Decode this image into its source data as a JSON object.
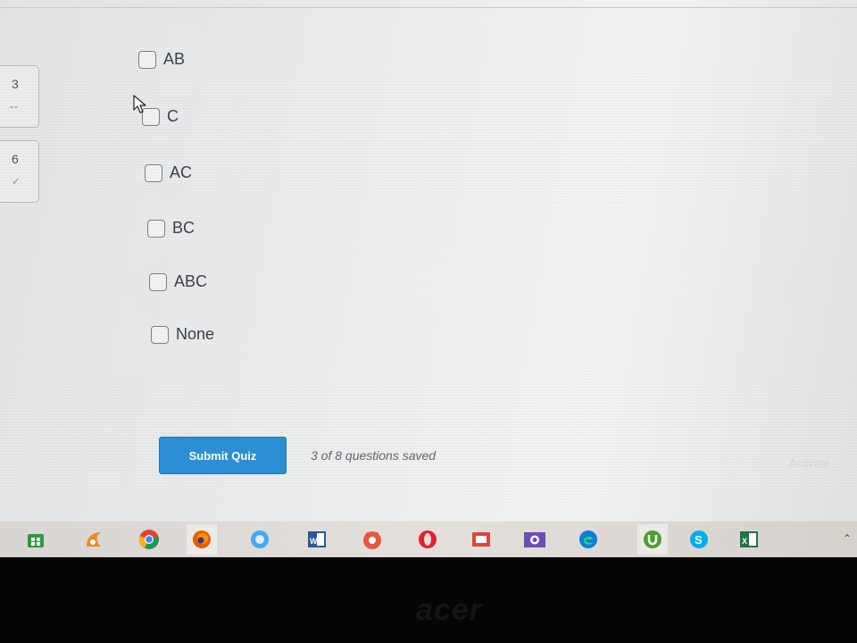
{
  "question_nav": [
    {
      "number": "3",
      "status": "--"
    },
    {
      "number": "6",
      "status": "✓"
    }
  ],
  "answer_options": [
    {
      "label": "AB",
      "checked": false
    },
    {
      "label": "C",
      "checked": false
    },
    {
      "label": "AC",
      "checked": false
    },
    {
      "label": "BC",
      "checked": false
    },
    {
      "label": "ABC",
      "checked": false
    },
    {
      "label": "None",
      "checked": false
    }
  ],
  "footer": {
    "submit_label": "Submit Quiz",
    "saved_status": "3 of 8 questions saved"
  },
  "watermark": "Activate",
  "taskbar": {
    "icons": [
      "store-icon",
      "uc-browser-icon",
      "chrome-icon",
      "firefox-icon",
      "browser-icon",
      "word-icon",
      "media-icon",
      "opera-icon",
      "presentation-icon",
      "camera-icon",
      "edge-icon",
      "utorrent-icon",
      "skype-icon",
      "excel-icon"
    ],
    "tray_chevron": "⌃"
  },
  "bezel_logo": "acer",
  "colors": {
    "submit_button": "#2b8fd6",
    "screen_background": "#ececed",
    "taskbar": "#ddd9d5"
  }
}
